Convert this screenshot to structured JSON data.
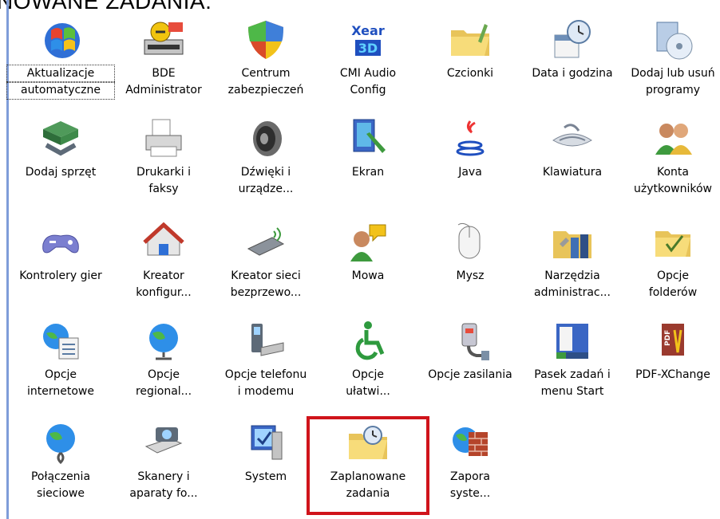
{
  "caption": "NOWANE ZADANIA:",
  "items": [
    {
      "line1": "Aktualizacje",
      "line2": "automatyczne",
      "icon": "windows-update-icon"
    },
    {
      "line1": "BDE",
      "line2": "Administrator",
      "icon": "bde-admin-icon"
    },
    {
      "line1": "Centrum",
      "line2": "zabezpieczeń",
      "icon": "security-shield-icon"
    },
    {
      "line1": "CMI Audio",
      "line2": "Config",
      "icon": "xear-3d-icon"
    },
    {
      "line1": "Czcionki",
      "line2": "",
      "icon": "fonts-folder-icon"
    },
    {
      "line1": "Data i godzina",
      "line2": "",
      "icon": "clock-calendar-icon"
    },
    {
      "line1": "Dodaj lub usuń",
      "line2": "programy",
      "icon": "add-remove-programs-icon"
    },
    {
      "line1": "Dodaj sprzęt",
      "line2": "",
      "icon": "add-hardware-icon"
    },
    {
      "line1": "Drukarki i",
      "line2": "faksy",
      "icon": "printer-icon"
    },
    {
      "line1": "Dźwięki i",
      "line2": "urządze...",
      "icon": "speaker-icon"
    },
    {
      "line1": "Ekran",
      "line2": "",
      "icon": "display-icon"
    },
    {
      "line1": "Java",
      "line2": "",
      "icon": "java-cup-icon"
    },
    {
      "line1": "Klawiatura",
      "line2": "",
      "icon": "keyboard-icon"
    },
    {
      "line1": "Konta",
      "line2": "użytkowników",
      "icon": "user-accounts-icon"
    },
    {
      "line1": "Kontrolery gier",
      "line2": "",
      "icon": "gamepad-icon"
    },
    {
      "line1": "Kreator",
      "line2": "konfigur...",
      "icon": "network-house-icon"
    },
    {
      "line1": "Kreator sieci",
      "line2": "bezprzewo...",
      "icon": "wireless-adapter-icon"
    },
    {
      "line1": "Mowa",
      "line2": "",
      "icon": "speech-icon"
    },
    {
      "line1": "Mysz",
      "line2": "",
      "icon": "mouse-icon"
    },
    {
      "line1": "Narzędzia",
      "line2": "administrac...",
      "icon": "admin-tools-icon"
    },
    {
      "line1": "Opcje",
      "line2": "folderów",
      "icon": "folder-options-icon"
    },
    {
      "line1": "Opcje",
      "line2": "internetowe",
      "icon": "internet-options-icon"
    },
    {
      "line1": "Opcje",
      "line2": "regional...",
      "icon": "globe-icon"
    },
    {
      "line1": "Opcje telefonu",
      "line2": "i modemu",
      "icon": "phone-modem-icon"
    },
    {
      "line1": "Opcje",
      "line2": "ułatwi...",
      "icon": "accessibility-icon"
    },
    {
      "line1": "Opcje zasilania",
      "line2": "",
      "icon": "power-options-icon"
    },
    {
      "line1": "Pasek zadań i",
      "line2": "menu Start",
      "icon": "taskbar-icon"
    },
    {
      "line1": "PDF-XChange",
      "line2": "",
      "icon": "pdf-xchange-icon"
    },
    {
      "line1": "Połączenia",
      "line2": "sieciowe",
      "icon": "network-connections-icon"
    },
    {
      "line1": "Skanery i",
      "line2": "aparaty fo...",
      "icon": "scanner-camera-icon"
    },
    {
      "line1": "System",
      "line2": "",
      "icon": "system-icon"
    },
    {
      "line1": "Zaplanowane",
      "line2": "zadania",
      "icon": "scheduled-tasks-icon"
    },
    {
      "line1": "Zapora",
      "line2": "syste...",
      "icon": "firewall-icon"
    }
  ]
}
